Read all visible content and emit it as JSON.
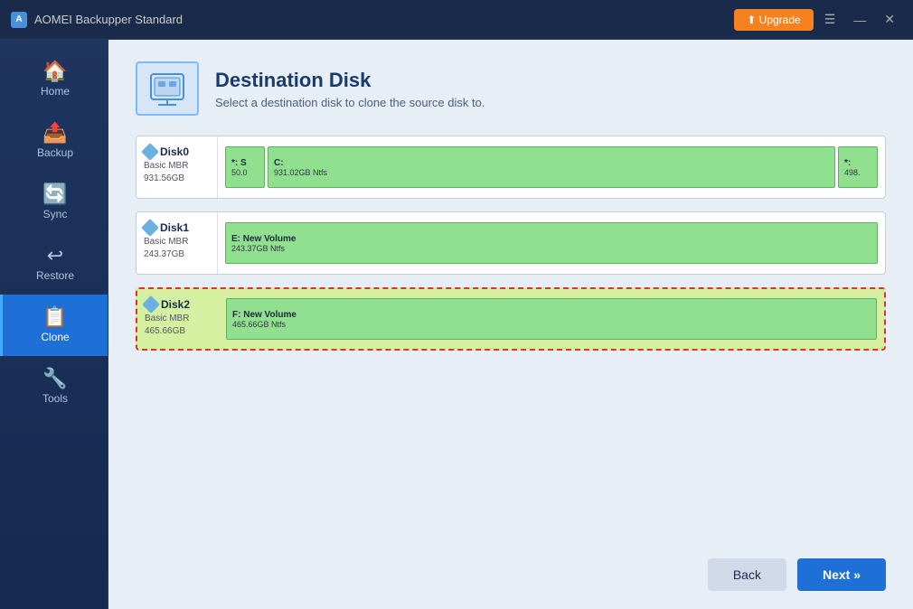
{
  "app": {
    "title": "AOMEI Backupper Standard",
    "upgrade_label": "⬆ Upgrade"
  },
  "titlebar": {
    "menu_icon": "☰",
    "minimize_icon": "—",
    "close_icon": "✕"
  },
  "sidebar": {
    "items": [
      {
        "id": "home",
        "label": "Home",
        "icon": "🏠"
      },
      {
        "id": "backup",
        "label": "Backup",
        "icon": "📤"
      },
      {
        "id": "sync",
        "label": "Sync",
        "icon": "🔄"
      },
      {
        "id": "restore",
        "label": "Restore",
        "icon": "↩"
      },
      {
        "id": "clone",
        "label": "Clone",
        "icon": "📋",
        "active": true
      },
      {
        "id": "tools",
        "label": "Tools",
        "icon": "🔧"
      }
    ]
  },
  "page": {
    "title": "Destination Disk",
    "subtitle": "Select a destination disk to clone the source disk to.",
    "icon": "🖥"
  },
  "disks": [
    {
      "id": "disk0",
      "name": "Disk0",
      "type": "Basic MBR",
      "size": "931.56GB",
      "selected": false,
      "partitions": [
        {
          "id": "p0-1",
          "label": "*: S",
          "sub": "50.0",
          "type": "small"
        },
        {
          "id": "p0-2",
          "label": "C:",
          "sub": "931.02GB Ntfs",
          "type": "large"
        },
        {
          "id": "p0-3",
          "label": "*:",
          "sub": "498.",
          "type": "small"
        }
      ]
    },
    {
      "id": "disk1",
      "name": "Disk1",
      "type": "Basic MBR",
      "size": "243.37GB",
      "selected": false,
      "partitions": [
        {
          "id": "p1-1",
          "label": "E: New Volume",
          "sub": "243.37GB Ntfs",
          "type": "full"
        }
      ]
    },
    {
      "id": "disk2",
      "name": "Disk2",
      "type": "Basic MBR",
      "size": "465.66GB",
      "selected": true,
      "partitions": [
        {
          "id": "p2-1",
          "label": "F: New Volume",
          "sub": "465.66GB Ntfs",
          "type": "full"
        }
      ]
    }
  ],
  "footer": {
    "back_label": "Back",
    "next_label": "Next »"
  }
}
